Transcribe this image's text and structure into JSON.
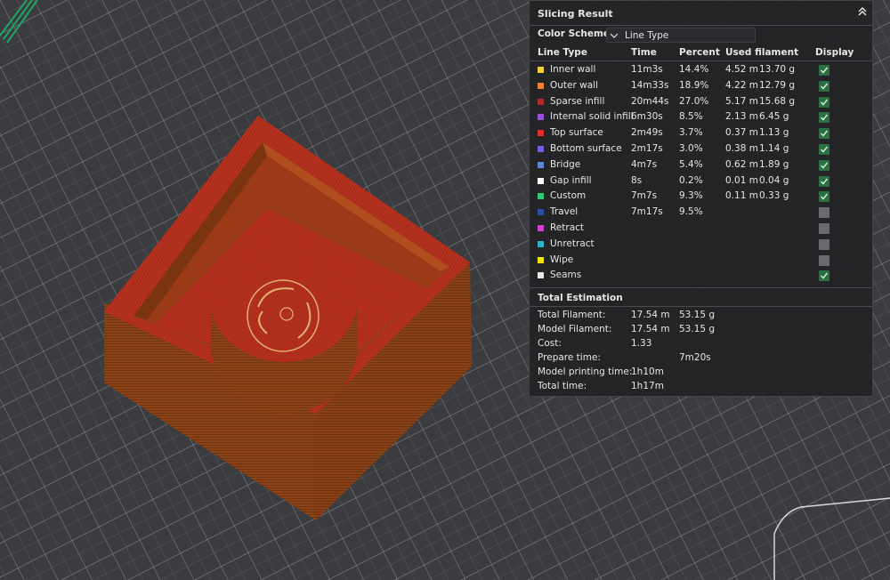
{
  "panel": {
    "title": "Slicing Result",
    "color_scheme_label": "Color Scheme",
    "color_scheme_value": "Line Type",
    "headers": {
      "line_type": "Line Type",
      "time": "Time",
      "percent": "Percent",
      "used_filament": "Used filament",
      "display": "Display"
    },
    "rows": [
      {
        "name": "Inner wall",
        "color": "#f4d03f",
        "time": "11m3s",
        "percent": "14.4%",
        "length": "4.52 m",
        "weight": "13.70 g",
        "display": true
      },
      {
        "name": "Outer wall",
        "color": "#f07f3c",
        "time": "14m33s",
        "percent": "18.9%",
        "length": "4.22 m",
        "weight": "12.79 g",
        "display": true
      },
      {
        "name": "Sparse infill",
        "color": "#b22a2a",
        "time": "20m44s",
        "percent": "27.0%",
        "length": "5.17 m",
        "weight": "15.68 g",
        "display": true
      },
      {
        "name": "Internal solid infill",
        "color": "#9b4fd6",
        "time": "6m30s",
        "percent": "8.5%",
        "length": "2.13 m",
        "weight": "6.45 g",
        "display": true
      },
      {
        "name": "Top surface",
        "color": "#e0302c",
        "time": "2m49s",
        "percent": "3.7%",
        "length": "0.37 m",
        "weight": "1.13 g",
        "display": true
      },
      {
        "name": "Bottom surface",
        "color": "#7a5cd8",
        "time": "2m17s",
        "percent": "3.0%",
        "length": "0.38 m",
        "weight": "1.14 g",
        "display": true
      },
      {
        "name": "Bridge",
        "color": "#5b8ad0",
        "time": "4m7s",
        "percent": "5.4%",
        "length": "0.62 m",
        "weight": "1.89 g",
        "display": true
      },
      {
        "name": "Gap infill",
        "color": "#ffffff",
        "time": "8s",
        "percent": "0.2%",
        "length": "0.01 m",
        "weight": "0.04 g",
        "display": true
      },
      {
        "name": "Custom",
        "color": "#2ecc71",
        "time": "7m7s",
        "percent": "9.3%",
        "length": "0.11 m",
        "weight": "0.33 g",
        "display": true
      },
      {
        "name": "Travel",
        "color": "#2c4f9e",
        "time": "7m17s",
        "percent": "9.5%",
        "length": "",
        "weight": "",
        "display": false
      },
      {
        "name": "Retract",
        "color": "#d63fd6",
        "time": "",
        "percent": "",
        "length": "",
        "weight": "",
        "display": false
      },
      {
        "name": "Unretract",
        "color": "#2bb3c9",
        "time": "",
        "percent": "",
        "length": "",
        "weight": "",
        "display": false
      },
      {
        "name": "Wipe",
        "color": "#f7e600",
        "time": "",
        "percent": "",
        "length": "",
        "weight": "",
        "display": false
      },
      {
        "name": "Seams",
        "color": "#e8e8e8",
        "time": "",
        "percent": "",
        "length": "",
        "weight": "",
        "display": true
      }
    ],
    "total_title": "Total Estimation",
    "totals": [
      {
        "label": "Total Filament:",
        "v1": "17.54 m",
        "v2": "53.15 g"
      },
      {
        "label": "Model Filament:",
        "v1": "17.54 m",
        "v2": "53.15 g"
      },
      {
        "label": "Cost:",
        "v1": "1.33",
        "v2": ""
      },
      {
        "label": "Prepare time:",
        "v1": "",
        "v2": "7m20s"
      },
      {
        "label": "Model printing time:",
        "v1": "1h10m",
        "v2": ""
      },
      {
        "label": "Total time:",
        "v1": "1h17m",
        "v2": ""
      }
    ]
  },
  "colors": {
    "background": "#3b3d40",
    "grid": "#9a9c9f",
    "model_side": "#8c4417",
    "model_top": "#b5331f",
    "check_on": "#2b6f43",
    "check_off": "#6a6b6e"
  }
}
